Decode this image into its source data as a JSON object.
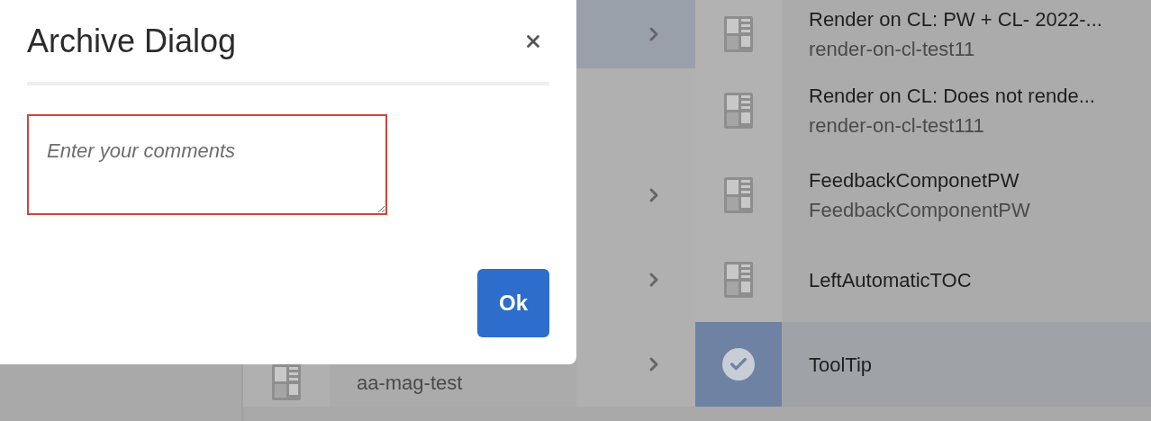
{
  "middle_column": {
    "rows": [
      {
        "selected": true,
        "has_children": true
      },
      {
        "selected": false,
        "has_children": false
      },
      {
        "selected": false,
        "has_children": true
      },
      {
        "selected": false,
        "has_children": true
      },
      {
        "selected": false,
        "has_children": true,
        "subtitle": "aa-mag-test"
      }
    ]
  },
  "right_column": {
    "rows": [
      {
        "title": "Render on CL: PW + CL- 2022-...",
        "subtitle": "render-on-cl-test11",
        "selected": false
      },
      {
        "title": "Render on CL: Does not rende...",
        "subtitle": "render-on-cl-test111",
        "selected": false
      },
      {
        "title": "FeedbackComponetPW",
        "subtitle": "FeedbackComponentPW",
        "selected": false
      },
      {
        "title": "LeftAutomaticTOC",
        "selected": false
      },
      {
        "title": "ToolTip",
        "selected": true
      }
    ]
  },
  "dialog": {
    "title": "Archive Dialog",
    "comment_field": {
      "placeholder": "Enter your comments",
      "invalid": true
    },
    "ok_button": "Ok"
  }
}
